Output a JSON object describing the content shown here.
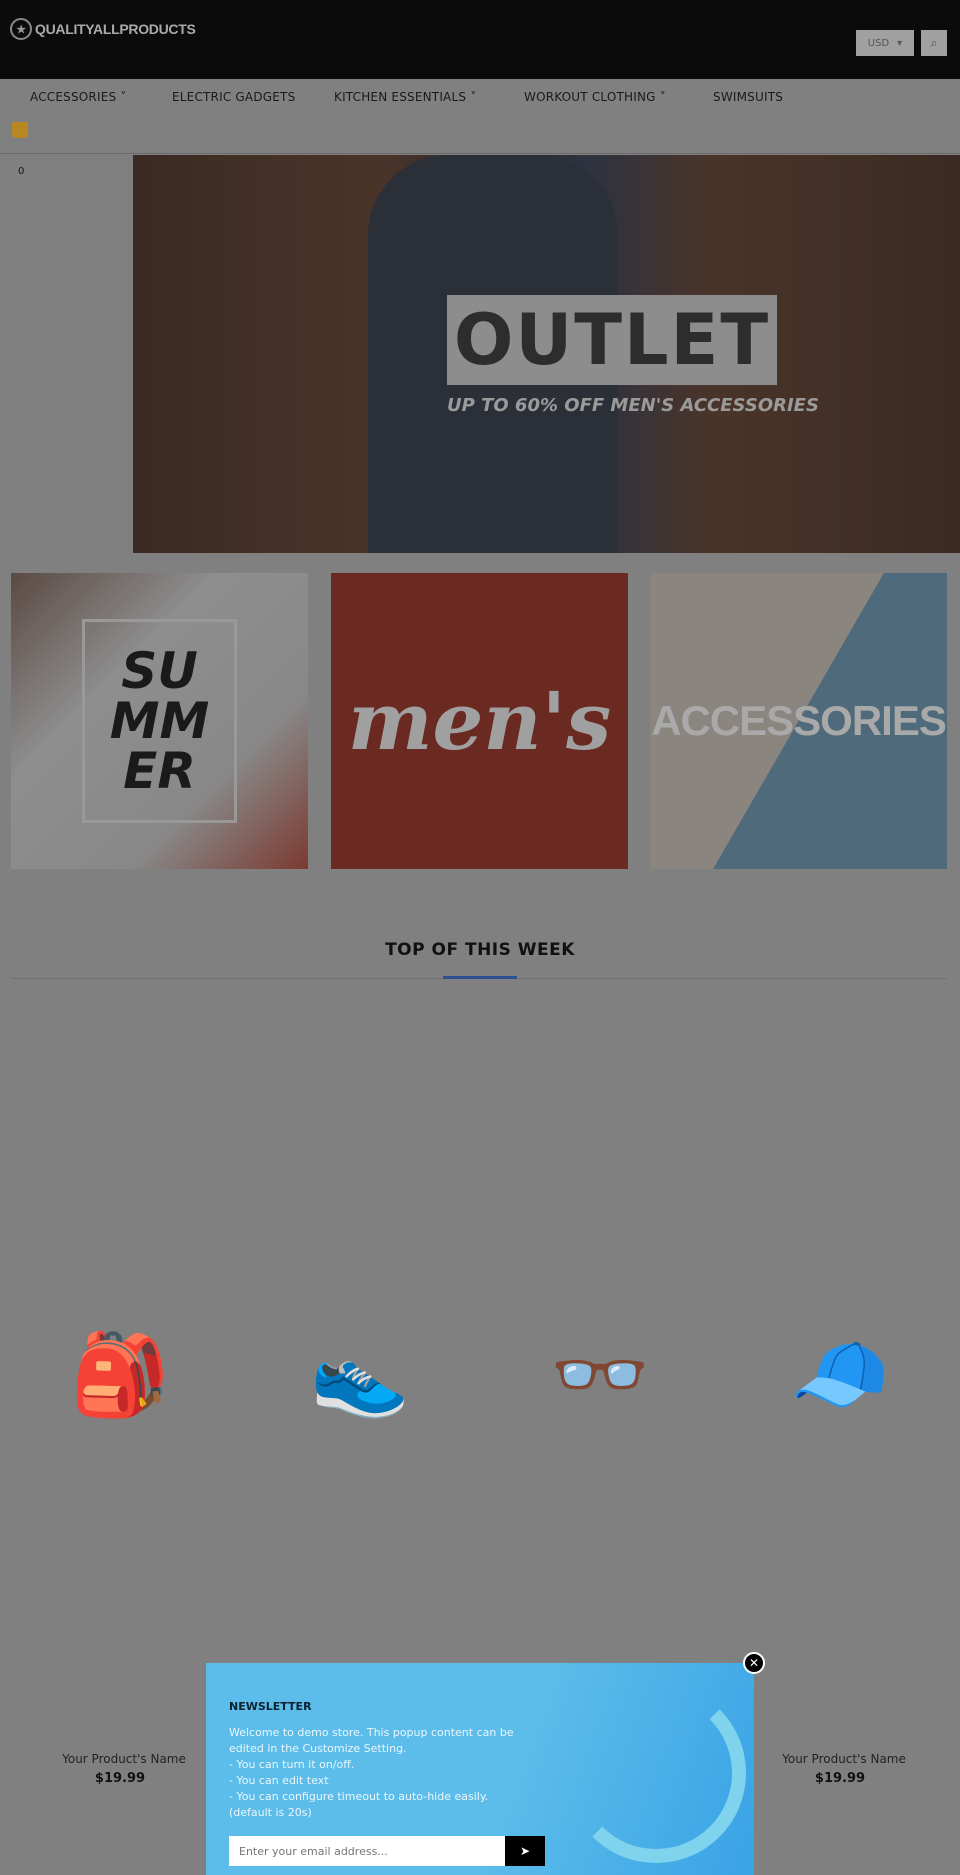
{
  "header": {
    "logo": "QUALITYALLPRODUCTS",
    "currency": "USD",
    "search_icon": "search-icon"
  },
  "nav": {
    "items": [
      {
        "label": "ACCESSORIES",
        "dropdown": true
      },
      {
        "label": "ELECTRIC GADGETS",
        "dropdown": false
      },
      {
        "label": "KITCHEN ESSENTIALS",
        "dropdown": true
      },
      {
        "label": "WORKOUT CLOTHING",
        "dropdown": true
      },
      {
        "label": "SWIMSUITS",
        "dropdown": false
      }
    ],
    "cart_count": "0"
  },
  "hero": {
    "title": "OUTLET",
    "subtitle": "UP TO 60% OFF MEN'S ACCESSORIES"
  },
  "banners": [
    {
      "text": "SU\nMM\nER"
    },
    {
      "text": "men's"
    },
    {
      "text": "ACCESSORIES"
    }
  ],
  "section": {
    "title": "TOP OF THIS WEEK",
    "accent": "#2d4f8f"
  },
  "products": [
    {
      "icon": "backpack-icon",
      "name": "Your Product's Name",
      "price": "$19.99"
    },
    {
      "icon": "sneaker-icon"
    },
    {
      "icon": "glasses-icon"
    },
    {
      "icon": "cap-icon",
      "name": "Your Product's Name",
      "price": "$19.99"
    }
  ],
  "popup": {
    "title": "NEWSLETTER",
    "text": "Welcome to demo store. This popup content can be edited in the Customize Setting.\n- You can turn it on/off.\n- You can edit text\n- You can configure timeout to auto-hide easily. (default is 20s)",
    "email_placeholder": "Enter your email address...",
    "bg": "#5cbdea"
  }
}
